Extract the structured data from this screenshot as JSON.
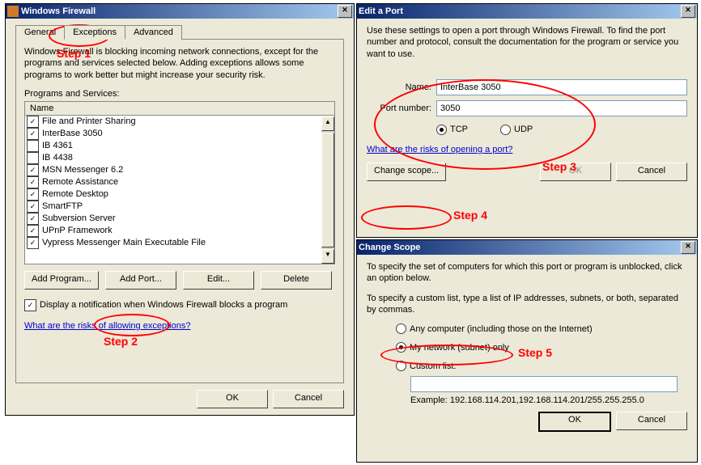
{
  "w1": {
    "title": "Windows Firewall",
    "tabs": [
      "General",
      "Exceptions",
      "Advanced"
    ],
    "activeTab": 1,
    "desc": "Windows Firewall is blocking incoming network connections, except for the programs and services selected below. Adding exceptions allows some programs to work better but might increase your security risk.",
    "listLabel": "Programs and Services:",
    "nameCol": "Name",
    "items": [
      {
        "checked": true,
        "label": "File and Printer Sharing"
      },
      {
        "checked": true,
        "label": "InterBase 3050"
      },
      {
        "checked": false,
        "label": "IB 4361"
      },
      {
        "checked": false,
        "label": "IB 4438"
      },
      {
        "checked": true,
        "label": "MSN Messenger 6.2"
      },
      {
        "checked": true,
        "label": "Remote Assistance"
      },
      {
        "checked": true,
        "label": "Remote Desktop"
      },
      {
        "checked": true,
        "label": "SmartFTP"
      },
      {
        "checked": true,
        "label": "Subversion Server"
      },
      {
        "checked": true,
        "label": "UPnP Framework"
      },
      {
        "checked": true,
        "label": "Vypress Messenger Main Executable File"
      }
    ],
    "btns": {
      "addProgram": "Add Program...",
      "addPort": "Add Port...",
      "edit": "Edit...",
      "delete": "Delete"
    },
    "notify": "Display a notification when Windows Firewall blocks a program",
    "risks": "What are the risks of allowing exceptions?",
    "ok": "OK",
    "cancel": "Cancel"
  },
  "w2": {
    "title": "Edit a Port",
    "desc": "Use these settings to open a port through Windows Firewall. To find the port number and protocol, consult the documentation for the program or service you want to use.",
    "nameLbl": "Name:",
    "nameVal": "InterBase 3050",
    "portLbl": "Port number:",
    "portVal": "3050",
    "tcp": "TCP",
    "udp": "UDP",
    "risks": "What are the risks of opening a port?",
    "scope": "Change scope...",
    "ok": "OK",
    "cancel": "Cancel"
  },
  "w3": {
    "title": "Change Scope",
    "desc1": "To specify the set of computers for which this port or program is unblocked, click an option below.",
    "desc2": "To specify a custom list, type a list of IP addresses, subnets, or both, separated by commas.",
    "opt1": "Any computer (including those on the Internet)",
    "opt2": "My network (subnet) only",
    "opt3": "Custom list:",
    "example": "Example: 192.168.114.201,192.168.114.201/255.255.255.0",
    "ok": "OK",
    "cancel": "Cancel"
  },
  "steps": {
    "s1": "Step 1",
    "s2": "Step 2",
    "s3": "Step 3",
    "s4": "Step 4",
    "s5": "Step 5"
  }
}
